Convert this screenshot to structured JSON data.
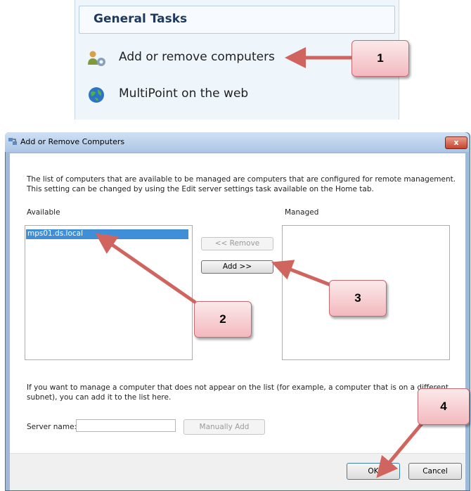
{
  "general_tasks": {
    "header": "General Tasks",
    "items": [
      {
        "label": "Add or remove computers",
        "icon": "users-gear-icon"
      },
      {
        "label": "MultiPoint on the web",
        "icon": "globe-icon"
      }
    ]
  },
  "dialog": {
    "title": "Add or Remove Computers",
    "close_label": "x",
    "description_line1": "The list of computers that are available to be managed are computers that are configured for remote management.",
    "description_line2": "This setting can be changed by using the Edit server settings task available on the Home tab.",
    "available_label": "Available",
    "managed_label": "Managed",
    "available_items": [
      "mps01.ds.local"
    ],
    "remove_button": "<< Remove",
    "add_button": "Add >>",
    "manual_hint_line1": "If you want to manage a computer that does not appear on the list (for example, a computer that is on a different",
    "manual_hint_line2": "subnet), you can add it to the list here.",
    "server_name_label": "Server name:",
    "server_name_value": "",
    "manually_add_button": "Manually Add",
    "ok_button": "OK",
    "cancel_button": "Cancel"
  },
  "callouts": [
    "1",
    "2",
    "3",
    "4"
  ],
  "colors": {
    "callout_fill": "#f3b9be",
    "arrow": "#d0645f",
    "selection": "#3f8fd8"
  }
}
